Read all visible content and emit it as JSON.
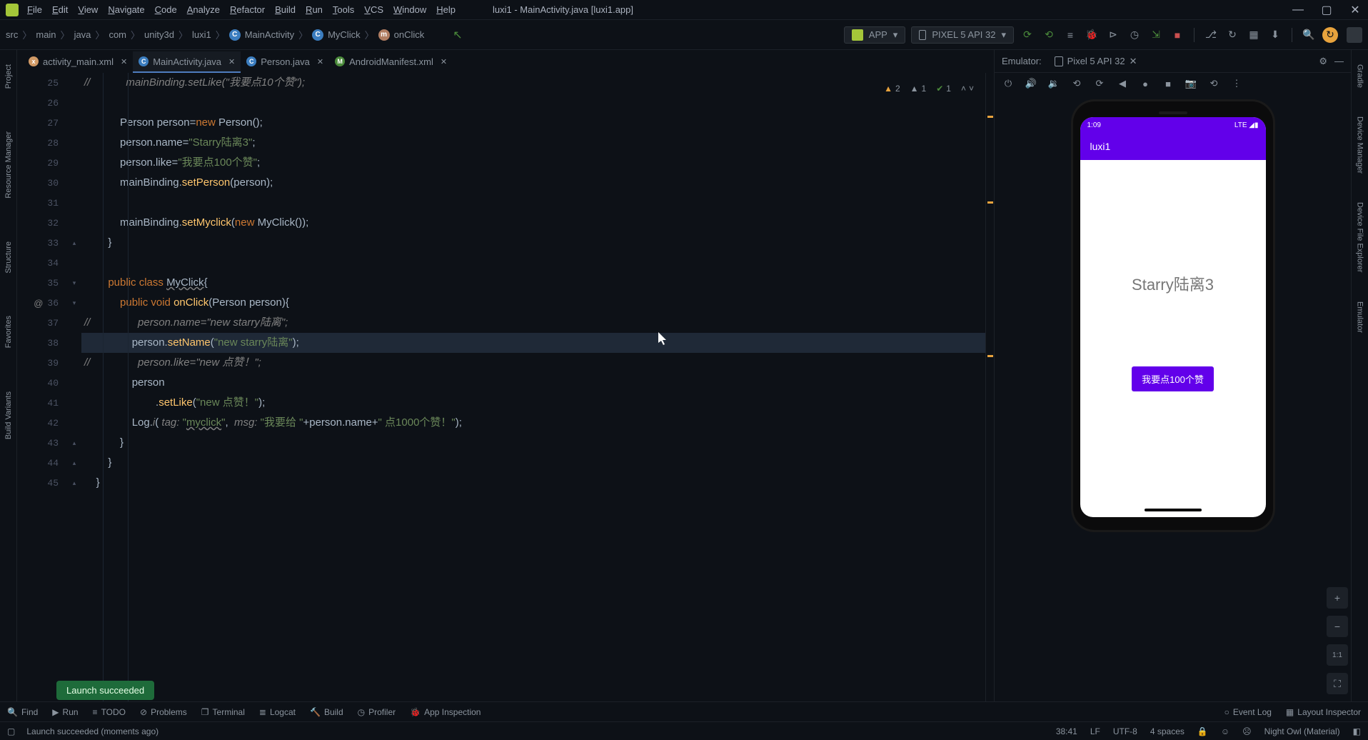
{
  "menu": {
    "items": [
      "File",
      "Edit",
      "View",
      "Navigate",
      "Code",
      "Analyze",
      "Refactor",
      "Build",
      "Run",
      "Tools",
      "VCS",
      "Window",
      "Help"
    ],
    "window_title": "luxi1 - MainActivity.java [luxi1.app]"
  },
  "breadcrumb": {
    "parts": [
      "src",
      "main",
      "java",
      "com",
      "unity3d",
      "luxi1",
      "MainActivity",
      "MyClick",
      "onClick"
    ]
  },
  "run_config": {
    "label": "APP"
  },
  "device_sel": {
    "label": "PIXEL 5 API 32"
  },
  "tabs": [
    {
      "name": "activity_main.xml",
      "active": false,
      "icon_color": "#d19a66",
      "icon_text": "xml"
    },
    {
      "name": "MainActivity.java",
      "active": true,
      "icon_color": "#3b7dbf",
      "icon_text": "C"
    },
    {
      "name": "Person.java",
      "active": false,
      "icon_color": "#3b7dbf",
      "icon_text": "C"
    },
    {
      "name": "AndroidManifest.xml",
      "active": false,
      "icon_color": "#4b8b3b",
      "icon_text": "MF"
    }
  ],
  "inspections": {
    "warn_tri_count": "2",
    "warn_count": "1",
    "check_count": "1"
  },
  "gutter_start": 25,
  "code_lines": [
    {
      "n": 25,
      "comment": true,
      "text": "//            mainBinding.setLike(\"我要点10个赞\");"
    },
    {
      "n": 26,
      "text": ""
    },
    {
      "n": 27,
      "html": "            <span class='type'>Person</span> <span class='ident'>person=</span><span class='kw'>new</span> <span class='ident'>Person();</span>"
    },
    {
      "n": 28,
      "html": "            <span class='ident'>person.name=</span><span class='str'>\"Starry陆离3\"</span><span class='ident'>;</span>"
    },
    {
      "n": 29,
      "html": "            <span class='ident'>person.like=</span><span class='str'>\"我要点100个赞\"</span><span class='ident'>;</span>"
    },
    {
      "n": 30,
      "html": "            <span class='ident'>mainBinding.</span><span class='method'>setPerson</span><span class='ident'>(person);</span>"
    },
    {
      "n": 31,
      "text": ""
    },
    {
      "n": 32,
      "html": "            <span class='ident'>mainBinding.</span><span class='method'>setMyclick</span><span class='ident'>(</span><span class='kw'>new</span> <span class='ident'>MyClick());</span>"
    },
    {
      "n": 33,
      "html": "        <span class='ident'>}</span>",
      "fold": "}"
    },
    {
      "n": 34,
      "text": ""
    },
    {
      "n": 35,
      "html": "        <span class='kw'>public class</span> <span class='ident wave'>MyClick</span><span class='ident'>{</span>",
      "fold": "{"
    },
    {
      "n": 36,
      "html": "            <span class='kw'>public void</span> <span class='method'>onClick</span><span class='ident'>(Person person){</span>",
      "gicon": "@",
      "fold": "{"
    },
    {
      "n": 37,
      "comment": true,
      "text": "//                person.name=\"new starry陆离\";"
    },
    {
      "n": 38,
      "hl": true,
      "html": "                <span class='ident'>person.</span><span class='method'>setName</span><span class='ident'>(</span><span class='str'>\"new starry陆离\"</span><span class='ident'>);</span>"
    },
    {
      "n": 39,
      "comment": true,
      "text": "//                person.like=\"new 点赞！\";"
    },
    {
      "n": 40,
      "html": "                <span class='ident'>person</span>"
    },
    {
      "n": 41,
      "html": "                        <span class='ident'>.</span><span class='method'>setLike</span><span class='ident'>(</span><span class='str'>\"new 点赞！\"</span><span class='ident'>);</span>"
    },
    {
      "n": 42,
      "html": "                <span class='ident'>Log.</span><span class='param'>i</span><span class='ident'>( </span><span class='param'>tag:</span> <span class='str'>\"<span class='wave'>myclick</span>\"</span><span class='ident'>,  </span><span class='param'>msg:</span> <span class='str'>\"我要给 \"</span><span class='ident'>+person.name+</span><span class='str'>\" 点1000个赞！\"</span><span class='ident'>);</span>"
    },
    {
      "n": 43,
      "html": "            <span class='ident'>}</span>",
      "fold": "}"
    },
    {
      "n": 44,
      "html": "        <span class='ident'>}</span>",
      "fold": "}"
    },
    {
      "n": 45,
      "html": "    <span class='ident'>}</span>",
      "fold": "}"
    }
  ],
  "emulator": {
    "label": "Emulator:",
    "tab": "Pixel 5 API 32",
    "status_time": "1:09",
    "status_right": "LTE ◢▮",
    "app_title": "luxi1",
    "big_text": "Starry陆离3",
    "button_text": "我要点100个赞"
  },
  "left_rail": [
    "Project",
    "Resource Manager",
    "Structure",
    "Favorites",
    "Build Variants"
  ],
  "right_rail": [
    "Gradle",
    "Device Manager",
    "Device File Explorer",
    "Emulator"
  ],
  "bottom_tools": [
    {
      "icon": "🔍",
      "label": "Find"
    },
    {
      "icon": "▶",
      "label": "Run"
    },
    {
      "icon": "≡",
      "label": "TODO"
    },
    {
      "icon": "⊘",
      "label": "Problems"
    },
    {
      "icon": "❐",
      "label": "Terminal"
    },
    {
      "icon": "≣",
      "label": "Logcat"
    },
    {
      "icon": "🔨",
      "label": "Build"
    },
    {
      "icon": "◷",
      "label": "Profiler"
    },
    {
      "icon": "🐞",
      "label": "App Inspection"
    }
  ],
  "bottom_right": [
    {
      "icon": "○",
      "label": "Event Log"
    },
    {
      "icon": "▦",
      "label": "Layout Inspector"
    }
  ],
  "status": {
    "msg": "Launch succeeded (moments ago)",
    "pos": "38:41",
    "lf": "LF",
    "enc": "UTF-8",
    "spaces": "4 spaces",
    "theme": "Night Owl (Material)"
  },
  "toast": "Launch succeeded"
}
